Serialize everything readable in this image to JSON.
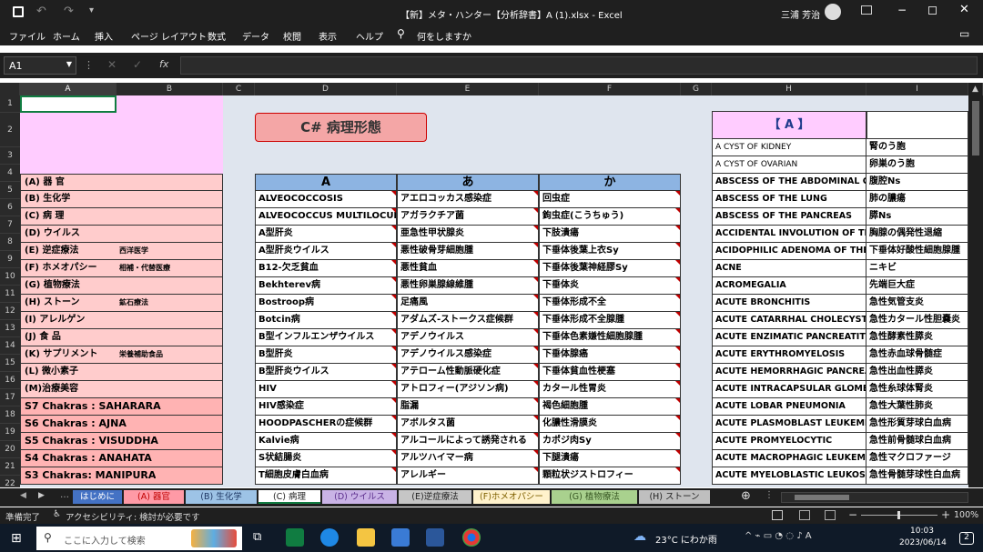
{
  "titlebar": {
    "title": "【新】メタ・ハンター【分析辞書】A (1).xlsx  -  Excel",
    "user": "三浦 芳治"
  },
  "menu": [
    "ファイル",
    "ホーム",
    "挿入",
    "ページ レイアウト",
    "数式",
    "データ",
    "校閲",
    "表示",
    "ヘルプ"
  ],
  "tellme": "何をしますか",
  "namebox": "A1",
  "columns": [
    "A",
    "B",
    "C",
    "D",
    "E",
    "F",
    "G",
    "H",
    "I"
  ],
  "rows": [
    "1",
    "2",
    "3",
    "4",
    "5",
    "6",
    "7",
    "8",
    "9",
    "10",
    "11",
    "12",
    "13",
    "14",
    "15",
    "16",
    "17",
    "18",
    "19",
    "20",
    "21",
    "22"
  ],
  "left_items": [
    {
      "main": "(A) 器 官",
      "sub": ""
    },
    {
      "main": "(B) 生化学",
      "sub": ""
    },
    {
      "main": "(C) 病 理",
      "sub": ""
    },
    {
      "main": "(D) ウイルス",
      "sub": ""
    },
    {
      "main": "(E) 逆症療法",
      "sub": "西洋医学"
    },
    {
      "main": "(F) ホメオパシー",
      "sub": "相補・代替医療"
    },
    {
      "main": "(G) 植物療法",
      "sub": ""
    },
    {
      "main": "(H) ストーン",
      "sub": "鉱石療法"
    },
    {
      "main": "(I) アレルゲン",
      "sub": ""
    },
    {
      "main": "(J) 食 品",
      "sub": ""
    },
    {
      "main": "(K) サプリメント",
      "sub": "栄養補助食品"
    },
    {
      "main": "(L) 微小素子",
      "sub": ""
    },
    {
      "main": "(M)治療美容",
      "sub": ""
    },
    {
      "main": "S7 Chakras : SAHARARA",
      "sub": ""
    },
    {
      "main": "S6 Chakras : AJNA",
      "sub": ""
    },
    {
      "main": "S5 Chakras : VISUDDHA",
      "sub": ""
    },
    {
      "main": "S4 Chakras : ANAHATA",
      "sub": ""
    },
    {
      "main": "S3 Chakras: MANIPURA",
      "sub": ""
    }
  ],
  "page_title": "C# 病理形態",
  "table_headers": [
    "A",
    "あ",
    "か"
  ],
  "table_rows": [
    [
      "ALVEOCOCCOSIS",
      "アエロコッカス感染症",
      "回虫症"
    ],
    [
      "ALVEOCOCCUS MULTILOCULARIS",
      "アガラクチア菌",
      "鉤虫症(こうちゅう)"
    ],
    [
      "A型肝炎",
      "亜急性甲状腺炎",
      "下肢潰瘍"
    ],
    [
      "A型肝炎ウイルス",
      "悪性破骨芽細胞腫",
      "下垂体後葉上衣Sy"
    ],
    [
      "B12-欠乏貧血",
      "悪性貧血",
      "下垂体後葉神経膠Sy"
    ],
    [
      "Bekhterev病",
      "悪性卵巣腺線維腫",
      "下垂体炎"
    ],
    [
      "Bostroop病",
      "足痛風",
      "下垂体形成不全"
    ],
    [
      "Botcin病",
      "アダムズ-ストークス症候群",
      "下垂体形成不全腺腫"
    ],
    [
      "B型インフルエンザウイルス",
      "アデノウイルス",
      "下垂体色素嫌性細胞腺腫"
    ],
    [
      "B型肝炎",
      "アデノウイルス感染症",
      "下垂体腺癌"
    ],
    [
      "B型肝炎ウイルス",
      "アテローム性動脈硬化症",
      "下垂体貧血性梗塞"
    ],
    [
      "HIV",
      "アトロフィー(アジソン病)",
      "カタール性胃炎"
    ],
    [
      "HIV感染症",
      "脂漏",
      "褐色細胞腫"
    ],
    [
      "HOODPASCHERの症候群",
      "アボルタス菌",
      "化膿性滑膜炎"
    ],
    [
      "Kalvie病",
      "アルコールによって誘発される",
      "カポジ肉Sy"
    ],
    [
      "S状結腸炎",
      "アルツハイマー病",
      "下腿潰瘍"
    ],
    [
      "T細胞皮膚白血病",
      "アレルギー",
      "顆粒状ジストロフィー"
    ]
  ],
  "right_header": "【  A  】",
  "right_rows": [
    [
      "A CYST OF KIDNEY",
      "腎のう胞"
    ],
    [
      "A CYST OF OVARIAN",
      "卵巣のう胞"
    ],
    [
      "ABSCESS OF THE ABDOMINAL CAVITY",
      "腹腔Ns"
    ],
    [
      "ABSCESS OF THE LUNG",
      "肺の膿瘍"
    ],
    [
      "ABSCESS OF THE PANCREAS",
      "膵Ns"
    ],
    [
      "ACCIDENTAL INVOLUTION OF THYMUS",
      "胸腺の偶発性退縮"
    ],
    [
      "ACIDOPHILIC ADENOMA OF THE PITUITARY",
      "下垂体好酸性細胞腺腫"
    ],
    [
      "ACNE",
      "ニキビ"
    ],
    [
      "ACROMEGALIA",
      "先端巨大症"
    ],
    [
      "ACUTE BRONCHITIS",
      "急性気管支炎"
    ],
    [
      "ACUTE CATARRHAL CHOLECYSTITIS",
      "急性カタール性胆嚢炎"
    ],
    [
      "ACUTE ENZIMATIC PANCREATITIS",
      "急性酵素性膵炎"
    ],
    [
      "ACUTE ERYTHROMYELOSIS",
      "急性赤血球骨髄症"
    ],
    [
      "ACUTE HEMORRHAGIC PANCREATITIS",
      "急性出血性膵炎"
    ],
    [
      "ACUTE INTRACAPSULAR GLOMERULONEPHRITIS",
      "急性糸球体腎炎"
    ],
    [
      "ACUTE LOBAR PNEUMONIA",
      "急性大葉性肺炎"
    ],
    [
      "ACUTE PLASMOBLAST LEUKEMIA",
      "急性形質芽球白血病"
    ],
    [
      "ACUTE PROMYELOCYTIC",
      "急性前骨髄球白血病"
    ],
    [
      "ACUTE MACROPHAGIC LEUKEMIA",
      "急性マクロファージ"
    ],
    [
      "ACUTE MYELOBLASTIC LEUKOSIS",
      "急性骨髄芽球性白血病"
    ]
  ],
  "sheet_tabs": [
    {
      "label": "はじめに",
      "color": "#4472c4",
      "text": "#fff"
    },
    {
      "label": "(A) 器官",
      "color": "#ff9aa6",
      "text": "#c00000"
    },
    {
      "label": "(B) 生化学",
      "color": "#9dc3e6",
      "text": "#1f3864"
    },
    {
      "label": "(C) 病理",
      "color": "#ffffff",
      "text": "#222"
    },
    {
      "label": "(D) ウイルス",
      "color": "#c9b3e6",
      "text": "#5b2e8c"
    },
    {
      "label": "(E)逆症療法",
      "color": "#c6c6c6",
      "text": "#222"
    },
    {
      "label": "(F)ホメオパシー",
      "color": "#fff2cc",
      "text": "#7f6000"
    },
    {
      "label": "(G) 植物療法",
      "color": "#a9d18e",
      "text": "#375623"
    },
    {
      "label": "(H) ストーン",
      "color": "#bfbfbf",
      "text": "#222"
    }
  ],
  "status": {
    "ready": "準備完了",
    "accessibility": "アクセシビリティ: 検討が必要です",
    "zoom": "100%"
  },
  "taskbar": {
    "search": "ここに入力して検索",
    "weather": "23°C にわか雨",
    "time": "10:03",
    "date": "2023/06/14",
    "notif": "2"
  }
}
